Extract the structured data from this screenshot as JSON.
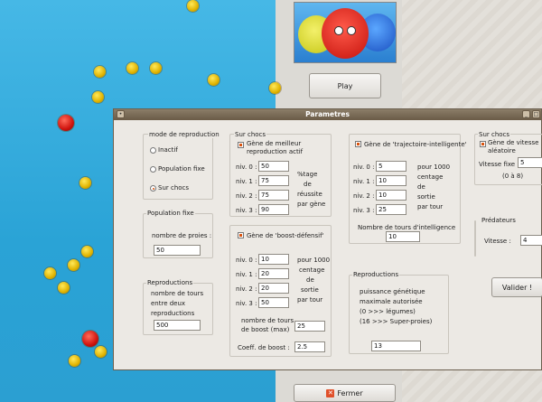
{
  "menu": {
    "play_label": "Play",
    "close_label": "Fermer"
  },
  "dialog": {
    "title": "Parametres",
    "repro_mode": {
      "title": "mode de reproduction",
      "options": [
        "Inactif",
        "Population fixe",
        "Sur chocs"
      ],
      "selected": "Sur chocs"
    },
    "fixed_pop": {
      "title": "Population fixe",
      "label": "nombre de proies :",
      "value": "50"
    },
    "reproductions_left": {
      "title": "Reproductions",
      "label_lines": [
        "nombre de tours",
        "entre deux",
        "reproductions"
      ],
      "value": "500"
    },
    "shock_best": {
      "title": "Sur chocs",
      "checkbox_lines": [
        "Gène de meilleur",
        "reproduction actif"
      ],
      "checked": true,
      "levels": [
        {
          "label": "niv. 0 :",
          "value": "50"
        },
        {
          "label": "niv. 1 :",
          "value": "75"
        },
        {
          "label": "niv. 2 :",
          "value": "75"
        },
        {
          "label": "niv. 3 :",
          "value": "90"
        }
      ],
      "note_lines": [
        "%tage",
        "de",
        "réussite",
        "par gène"
      ]
    },
    "boost": {
      "checkbox": "Gène de 'boost-défensif'",
      "checked": true,
      "levels": [
        {
          "label": "niv. 0 :",
          "value": "10"
        },
        {
          "label": "niv. 1 :",
          "value": "20"
        },
        {
          "label": "niv. 2 :",
          "value": "20"
        },
        {
          "label": "niv. 3 :",
          "value": "50"
        }
      ],
      "note_lines": [
        "pour 1000",
        "centage",
        "de",
        "sortie",
        "par tour"
      ],
      "max_label_lines": [
        "nombre de tours",
        "de boost (max)"
      ],
      "max_value": "25",
      "coeff_label": "Coeff. de boost :",
      "coeff_value": "2.5"
    },
    "trajectory": {
      "checkbox": "Gène de 'trajectoire-intelligente'",
      "checked": true,
      "levels": [
        {
          "label": "niv. 0 :",
          "value": "5"
        },
        {
          "label": "niv. 1 :",
          "value": "10"
        },
        {
          "label": "niv. 2 :",
          "value": "10"
        },
        {
          "label": "niv. 3 :",
          "value": "25"
        }
      ],
      "note_lines": [
        "pour 1000",
        "centage",
        "de",
        "sortie",
        "par tour"
      ],
      "turns_label": "Nombre de tours d'intelligence",
      "turns_value": "10"
    },
    "reproductions_right": {
      "title": "Reproductions",
      "label_lines": [
        "puissance génétique",
        "maximale autorisée",
        "(0 >>> légumes)",
        "(16 >>> Super-proies)"
      ],
      "value": "13"
    },
    "speed": {
      "title": "Sur chocs",
      "checkbox_lines": [
        "Gène de vitesse",
        "aléatoire"
      ],
      "checked": true,
      "fixed_label": "Vitesse fixe :",
      "fixed_value": "5",
      "range": "(0 à 8)"
    },
    "predators": {
      "title": "Prédateurs",
      "label": "Vitesse :",
      "value": "4"
    },
    "validate_label": "Valider !"
  }
}
